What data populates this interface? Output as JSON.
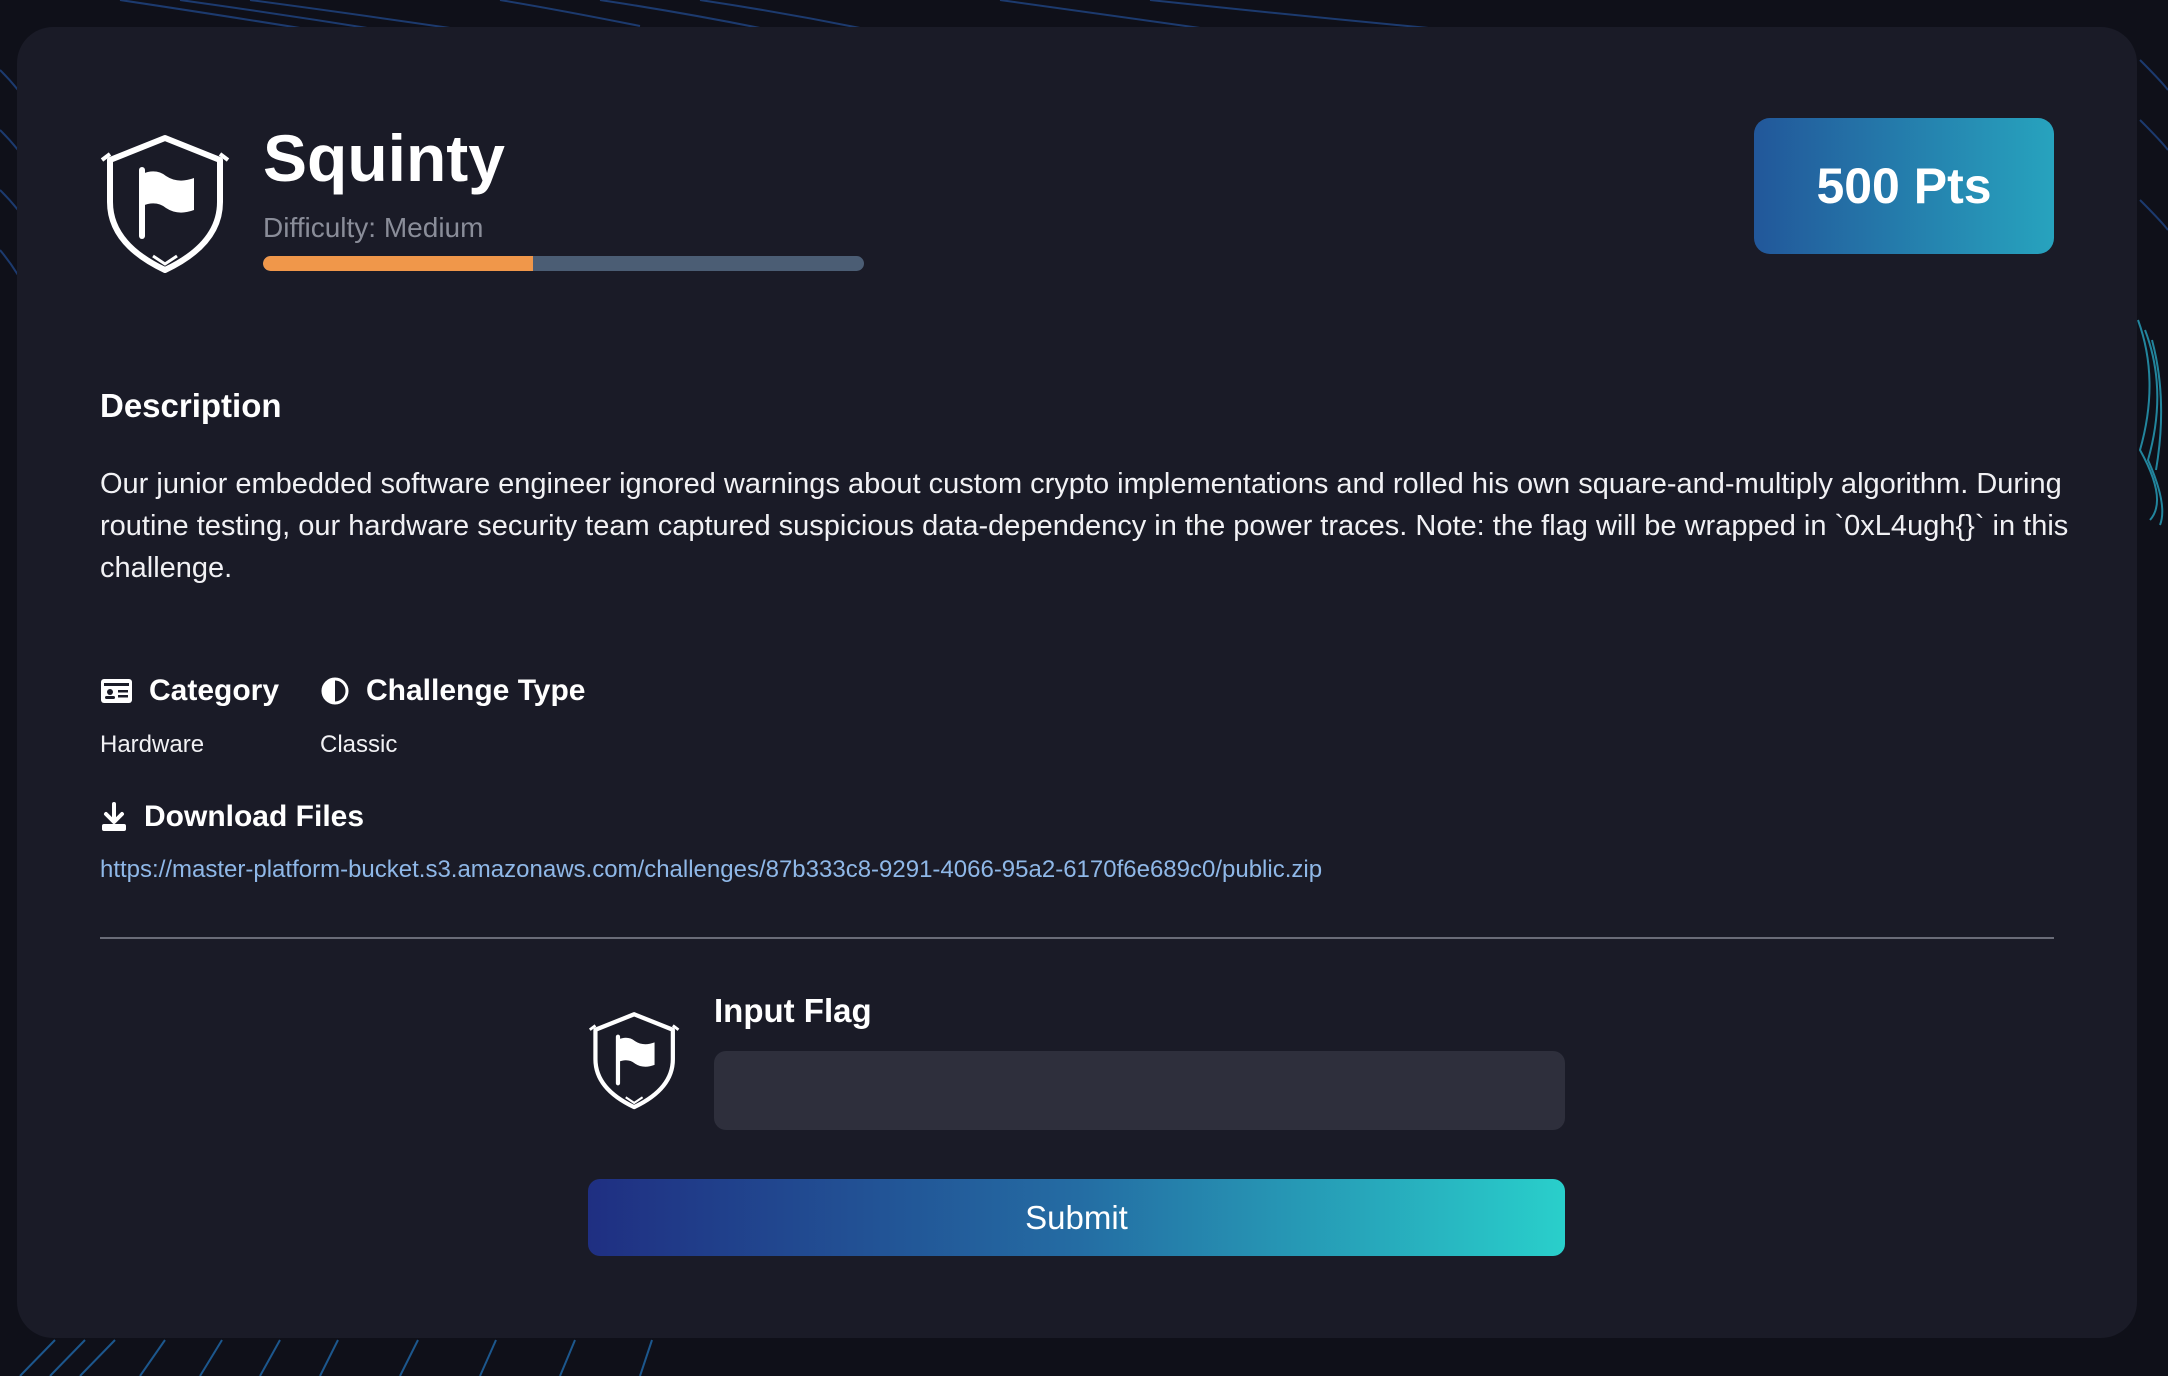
{
  "challenge": {
    "title": "Squinty",
    "difficulty_text": "Difficulty: Medium",
    "difficulty_progress": 0.45,
    "points": "500 Pts"
  },
  "description": {
    "heading": "Description",
    "text": "Our junior embedded software engineer ignored warnings about custom crypto implementations and rolled his own square-and-multiply algorithm. During routine testing, our hardware security team captured suspicious data-dependency in the power traces. Note: the flag will be wrapped in `0xL4ugh{}` in this challenge."
  },
  "meta": {
    "category_label": "Category",
    "category_value": "Hardware",
    "category_icon": "id-card-icon",
    "type_label": "Challenge Type",
    "type_value": "Classic",
    "type_icon": "half-circle-icon"
  },
  "downloads": {
    "label": "Download Files",
    "icon": "download-icon",
    "link": "https://master-platform-bucket.s3.amazonaws.com/challenges/87b333c8-9291-4066-95a2-6170f6e689c0/public.zip"
  },
  "flag_form": {
    "label": "Input Flag",
    "input_value": "",
    "submit_label": "Submit"
  },
  "colors": {
    "background": "#0f1019",
    "card": "#1a1b27",
    "progress_fill": "#f0974a",
    "progress_track": "#4b5d74",
    "link": "#8fb8e8",
    "accent_start": "#1f2f82",
    "accent_end": "#29cfcb"
  }
}
